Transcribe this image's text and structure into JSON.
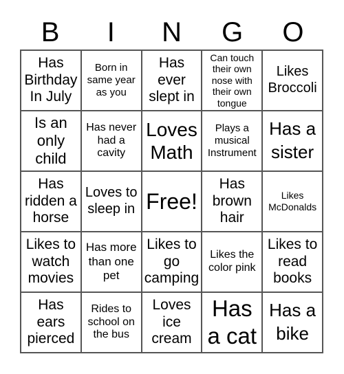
{
  "header": {
    "letters": [
      "B",
      "I",
      "N",
      "G",
      "O"
    ]
  },
  "cells": [
    "Has Birthday In July",
    "Born in same year as you",
    "Has ever slept in",
    "Can touch their own nose with their own tongue",
    "Likes Broccoli",
    "Is an only child",
    "Has never had a cavity",
    "Loves Math",
    "Plays a musical Instrument",
    "Has a sister",
    "Has ridden a horse",
    "Loves to sleep in",
    "Free!",
    "Has brown hair",
    "Likes McDonalds",
    "Likes to watch movies",
    "Has more than one pet",
    "Likes to go camping",
    "Likes the color pink",
    "Likes to read books",
    "Has ears pierced",
    "Rides to school on the bus",
    "Loves ice cream",
    "Has a cat",
    "Has a bike"
  ]
}
